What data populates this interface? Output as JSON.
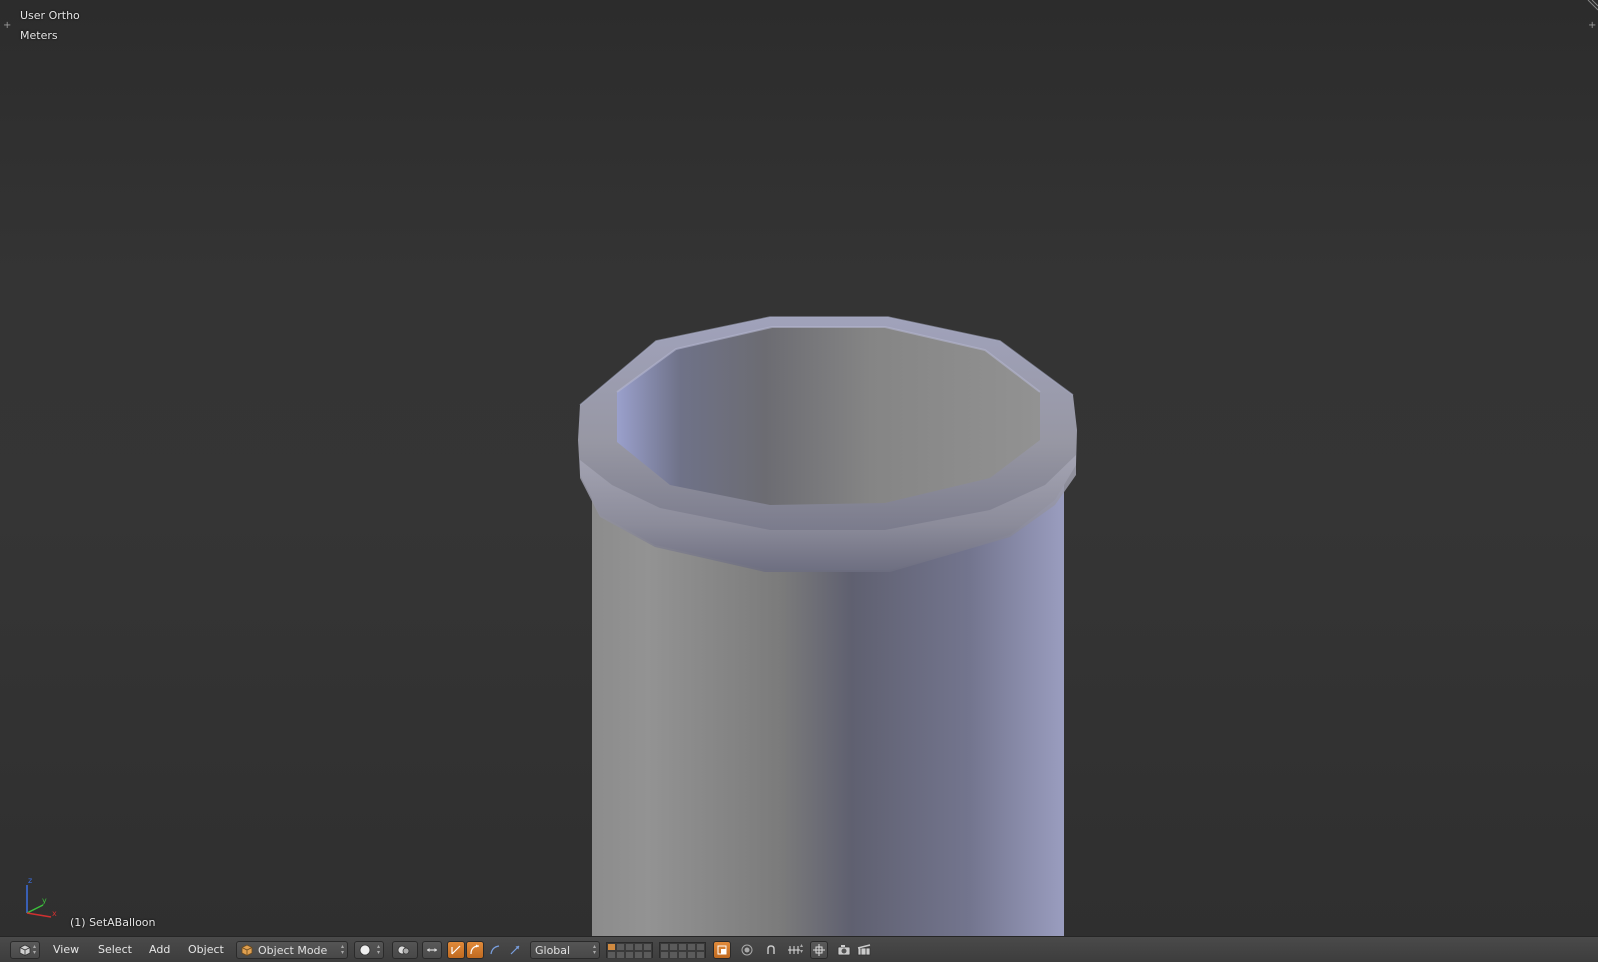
{
  "viewport": {
    "view_name": "User Ortho",
    "units": "Meters",
    "object_info": "(1) SetABalloon",
    "axis_labels": {
      "x": "x",
      "y": "y",
      "z": "z"
    },
    "colors": {
      "background_top": "#2c2c2c",
      "background_bottom": "#2f2f2f",
      "mesh_light": "#9a9aab",
      "mesh_mid": "#8a8a8a",
      "mesh_shadow": "#5e6070",
      "mesh_highlight": "#a3a6c8"
    }
  },
  "header": {
    "editor_type_icon": "3d-view-cube-icon",
    "menus": [
      "View",
      "Select",
      "Add",
      "Object"
    ],
    "mode": {
      "icon": "object-mode-cube-icon",
      "label": "Object Mode"
    },
    "viewport_shading_icon": "solid-sphere-icon",
    "pivot_icon": "pivot-point-icon",
    "manipulator_icons": [
      "manipulator-toggle-icon",
      "translate-icon",
      "rotate-icon",
      "scale-icon"
    ],
    "orientation": {
      "label": "Global"
    },
    "layers": {
      "group1_active": [
        0
      ],
      "group2_active": []
    },
    "lock_layers_icon": "lock-layers-icon",
    "proportional_icon": "proportional-edit-icon",
    "snap_icon": "snap-magnet-icon",
    "snap_element_icon": "snap-increment-icon",
    "snap_target_icon": "snap-target-icon",
    "render_icons": [
      "render-still-icon",
      "render-animation-icon"
    ],
    "accent_color": "#d08a40"
  }
}
